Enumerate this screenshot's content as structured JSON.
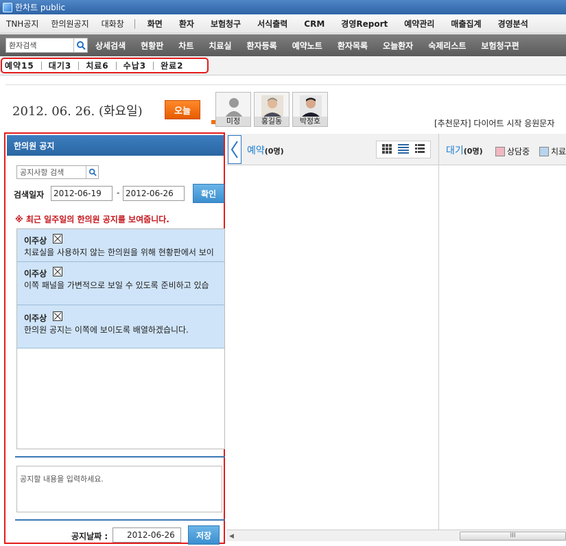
{
  "window": {
    "title": "한차트 public"
  },
  "menu": {
    "items": [
      "TNH공지",
      "한의원공지",
      "대화창"
    ],
    "bold_items": [
      "화면",
      "환자",
      "보험청구",
      "서식출력",
      "CRM",
      "경영Report",
      "예약관리",
      "매출집계",
      "경영분석"
    ]
  },
  "toolbar": {
    "search_placeholder": "환자검색",
    "items": [
      "상세검색",
      "현황판",
      "차트",
      "치료실",
      "환자등록",
      "예약노트",
      "환자목록",
      "오늘환자",
      "숙제리스트",
      "보험청구편"
    ]
  },
  "status": {
    "items": [
      "예약15",
      "대기3",
      "치료6",
      "수납3",
      "완료2"
    ],
    "notice": "[추천문자] 다이어트 시작 응원문자"
  },
  "date": {
    "text": "2012. 06. 26. (화요일)",
    "today_label": "오늘"
  },
  "doctors": [
    "미정",
    "홍길동",
    "박정호"
  ],
  "left_panel": {
    "title": "한의원 공지",
    "search_placeholder": "공지사항 검색",
    "date_label": "검색일자",
    "date_from": "2012-06-19",
    "date_sep": "-",
    "date_to": "2012-06-26",
    "confirm_label": "확인",
    "hint": "※ 최근 일주일의 한의원 공지를 보여줍니다.",
    "notices": [
      {
        "author": "이주상",
        "text": "치료실을 사용하지 않는 한의원을 위해 현황판에서 보이"
      },
      {
        "author": "이주상",
        "text": "이쪽 패널을 가변적으로 보일 수 있도록 준비하고 있습"
      },
      {
        "author": "이주상",
        "text": "한의원 공지는 이쪽에 보이도록 배열하겠습니다."
      }
    ],
    "input_placeholder": "공지할 내용을 입력하세요.",
    "notice_date_label": "공지날짜 :",
    "notice_date": "2012-06-26",
    "save_label": "저장"
  },
  "reservation": {
    "title": "예약",
    "count": "(0명)"
  },
  "waiting": {
    "title": "대기",
    "count": "(0명)",
    "legend": [
      {
        "label": "상담중",
        "color": "#f0b8c0"
      },
      {
        "label": "치료",
        "color": "#b9d4ee"
      }
    ]
  },
  "scrollbar": {
    "thumb_label": "III"
  },
  "colors": {
    "highlight_border": "#e41b1b",
    "accent_blue": "#2a66a3",
    "orange": "#f07010"
  }
}
